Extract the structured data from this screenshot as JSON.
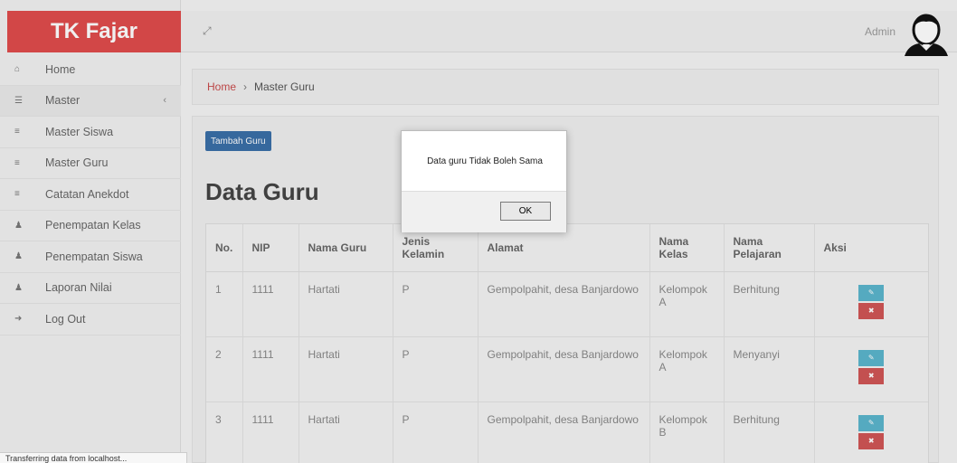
{
  "brand": "TK Fajar",
  "sidebar": {
    "items": [
      {
        "icon": "dashboard-icon",
        "glyph": "⌂",
        "label": "Home"
      },
      {
        "icon": "master-icon",
        "glyph": "☰",
        "label": "Master",
        "chevron": "‹"
      },
      {
        "icon": "list-icon",
        "glyph": "≡",
        "label": "Master Siswa"
      },
      {
        "icon": "list-icon",
        "glyph": "≡",
        "label": "Master Guru"
      },
      {
        "icon": "list-icon",
        "glyph": "≡",
        "label": "Catatan Anekdot"
      },
      {
        "icon": "user-icon",
        "glyph": "♟",
        "label": "Penempatan Kelas"
      },
      {
        "icon": "user-icon",
        "glyph": "♟",
        "label": "Penempatan Siswa"
      },
      {
        "icon": "user-icon",
        "glyph": "♟",
        "label": "Laporan Nilai"
      },
      {
        "icon": "logout-icon",
        "glyph": "➜",
        "label": "Log Out"
      }
    ]
  },
  "header": {
    "expand_glyph": "⤢",
    "user_label": "Admin"
  },
  "breadcrumb": {
    "home": "Home",
    "separator": "›",
    "current": "Master Guru"
  },
  "main": {
    "add_button": "Tambah Guru",
    "title": "Data Guru",
    "columns": [
      "No.",
      "NIP",
      "Nama Guru",
      "Jenis Kelamin",
      "Alamat",
      "Nama Kelas",
      "Nama Pelajaran",
      "Aksi"
    ],
    "rows": [
      {
        "no": "1",
        "nip": "1111",
        "nama": "Hartati",
        "jk": "P",
        "alamat": "Gempolpahit, desa Banjardowo",
        "kelas": "Kelompok A",
        "pelajaran": "Berhitung"
      },
      {
        "no": "2",
        "nip": "1111",
        "nama": "Hartati",
        "jk": "P",
        "alamat": "Gempolpahit, desa Banjardowo",
        "kelas": "Kelompok A",
        "pelajaran": "Menyanyi"
      },
      {
        "no": "3",
        "nip": "1111",
        "nama": "Hartati",
        "jk": "P",
        "alamat": "Gempolpahit, desa Banjardowo",
        "kelas": "Kelompok B",
        "pelajaran": "Berhitung"
      }
    ],
    "edit_glyph": "✎",
    "delete_glyph": "✖"
  },
  "dialog": {
    "message": "Data guru Tidak Boleh Sama",
    "ok_label": "OK"
  },
  "status_bar": "Transferring data from localhost..."
}
